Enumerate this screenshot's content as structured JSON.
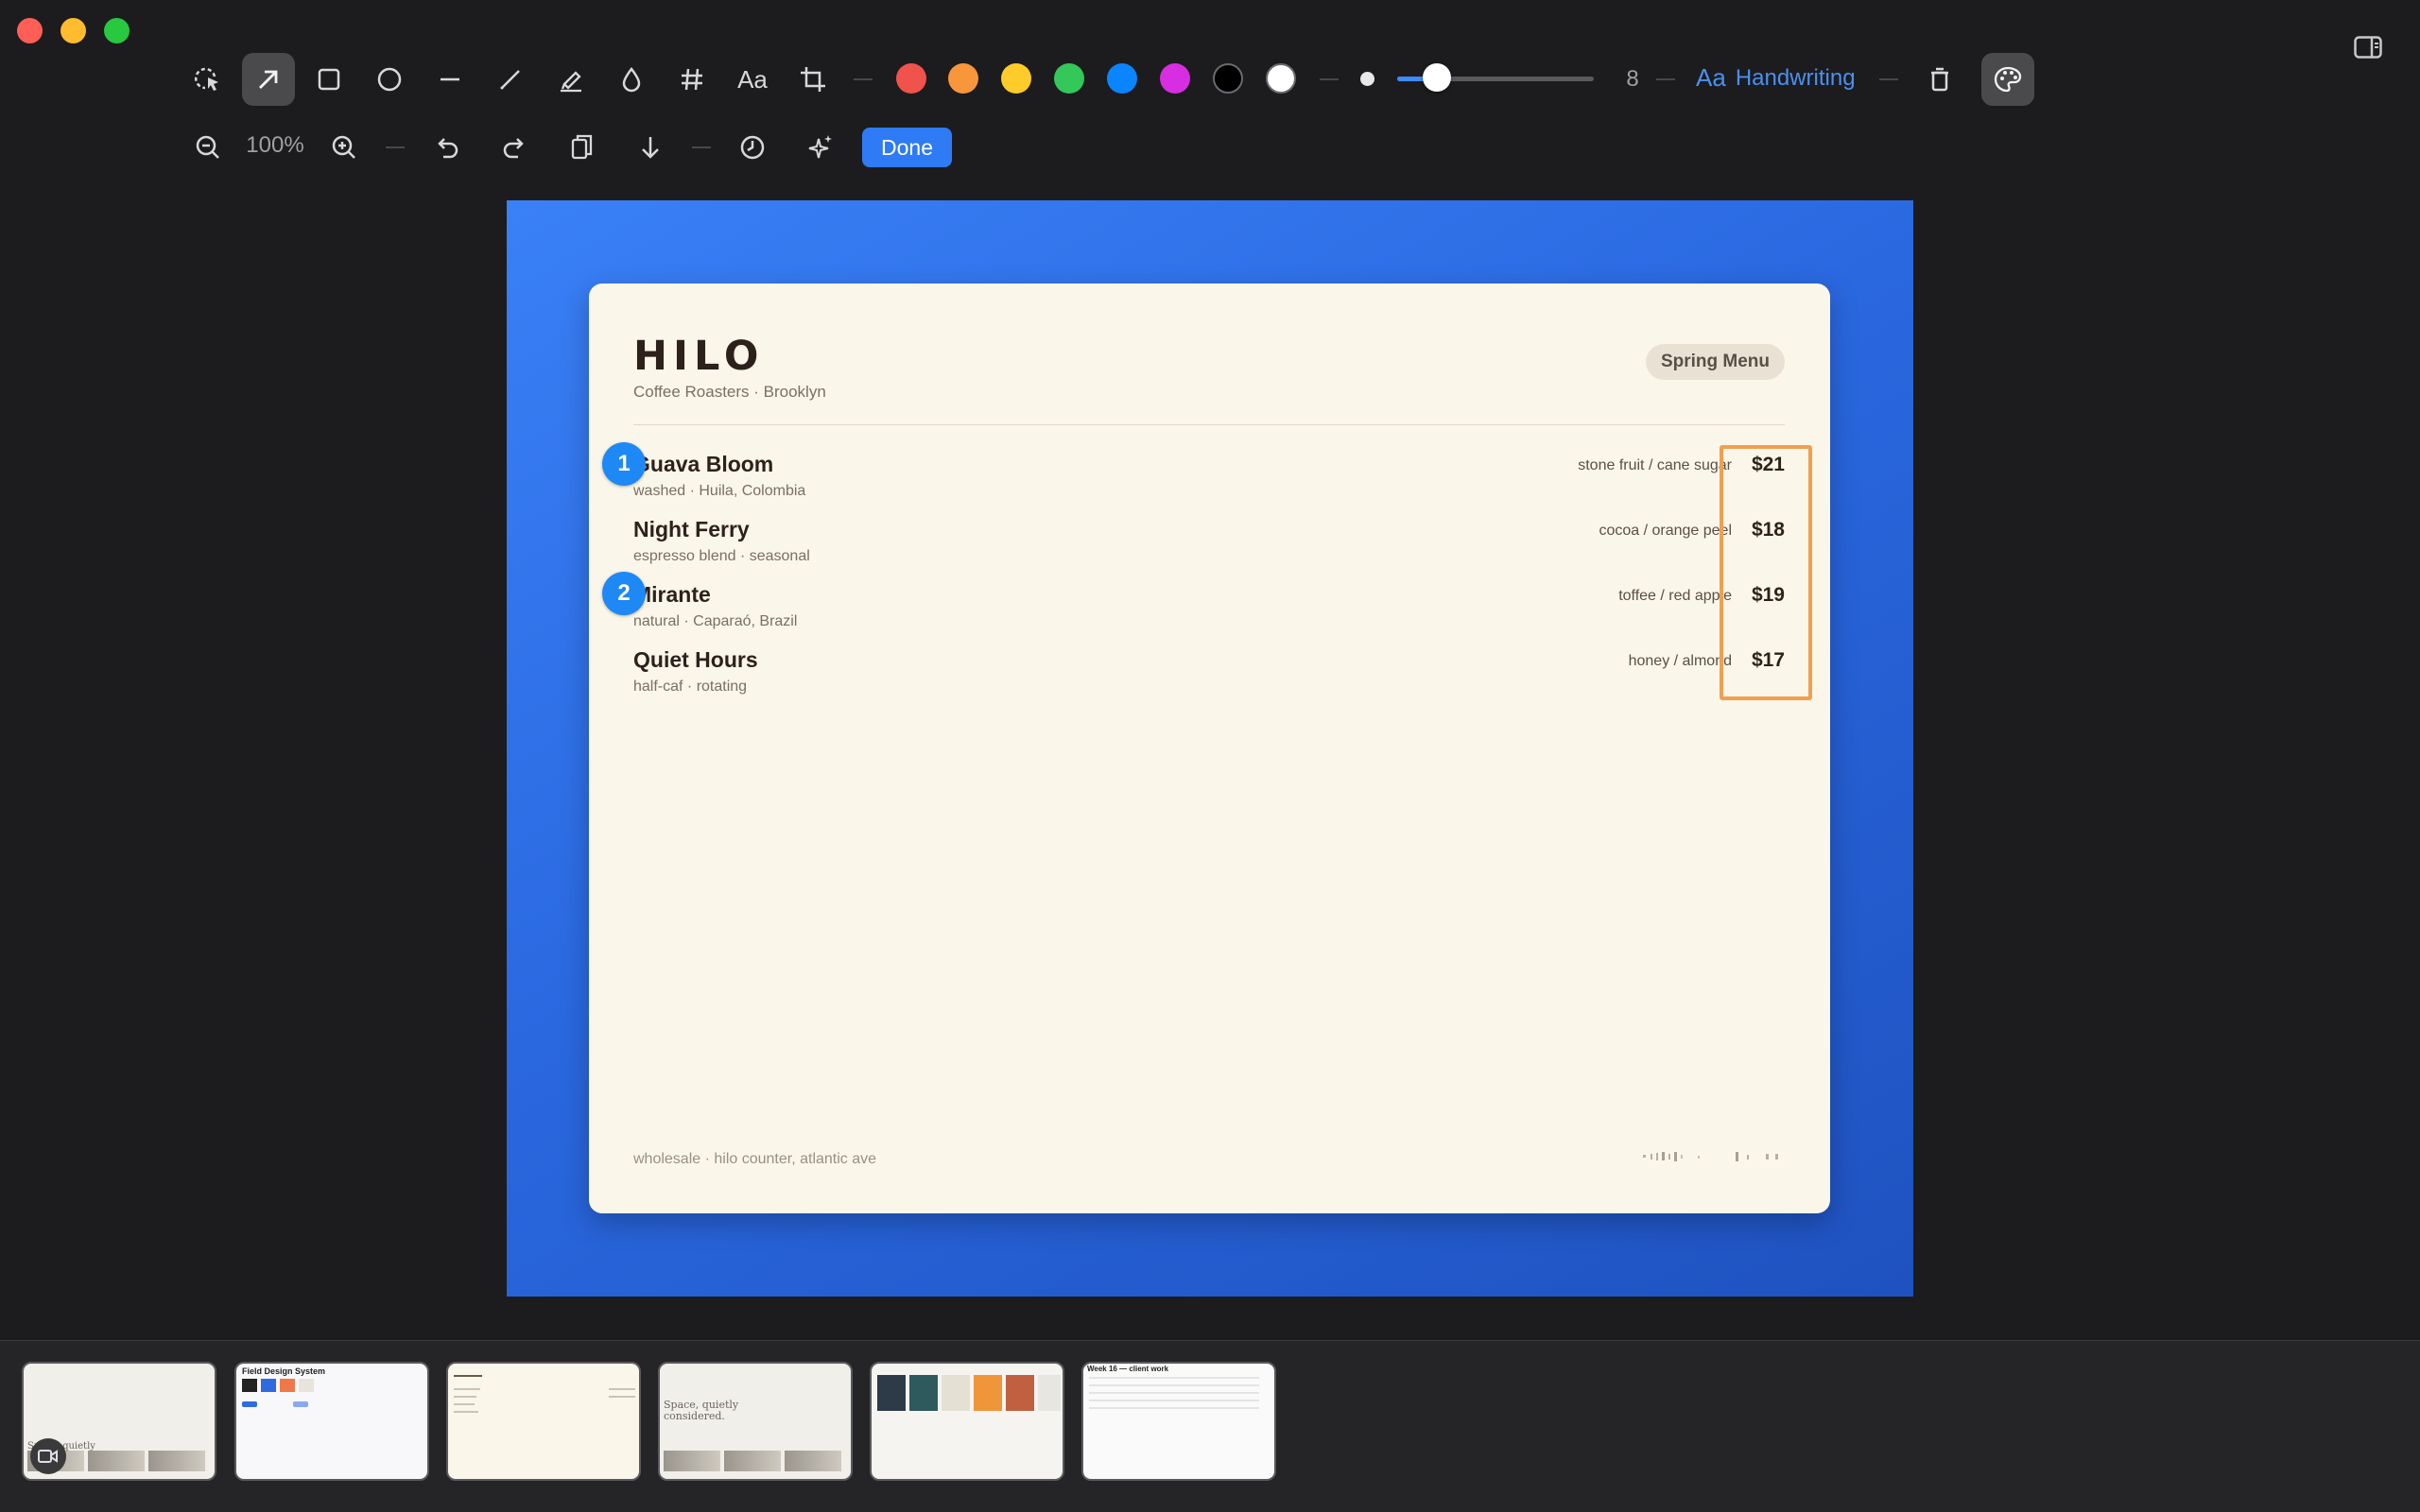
{
  "toolbar": {
    "zoom_level": "100%",
    "stroke_size": "8",
    "font_label": "Handwriting",
    "font_prefix": "Aa",
    "done_label": "Done",
    "text_tool_label": "Aa",
    "colors": [
      "#f0524c",
      "#f7963b",
      "#fdcb2a",
      "#34c759",
      "#0a84ff",
      "#d62ee0",
      "#000000",
      "#ffffff"
    ],
    "stroke_value": 0.2
  },
  "menu": {
    "brand": "HILO",
    "tagline": "Coffee Roasters · Brooklyn",
    "badge": "Spring Menu",
    "items": [
      {
        "name": "Guava Bloom",
        "sub": "washed · Huila, Colombia",
        "notes": "stone fruit / cane sugar",
        "price": "$21"
      },
      {
        "name": "Night Ferry",
        "sub": "espresso blend · seasonal",
        "notes": "cocoa / orange peel",
        "price": "$18"
      },
      {
        "name": "Mirante",
        "sub": "natural · Caparaó, Brazil",
        "notes": "toffee / red apple",
        "price": "$19"
      },
      {
        "name": "Quiet Hours",
        "sub": "half-caf · rotating",
        "notes": "honey / almond",
        "price": "$17"
      }
    ],
    "footer": "wholesale · hilo counter, atlantic ave"
  },
  "annotations": {
    "badge1": "1",
    "badge2": "2",
    "highlight_color": "#f0a050"
  },
  "filmstrip": {
    "thumb1_text": "Space, quietly considered.",
    "thumb2_text": "Field Design System",
    "thumb4_text": "Space, quietly considered.",
    "thumb6_text": "Week 16 — client work"
  }
}
